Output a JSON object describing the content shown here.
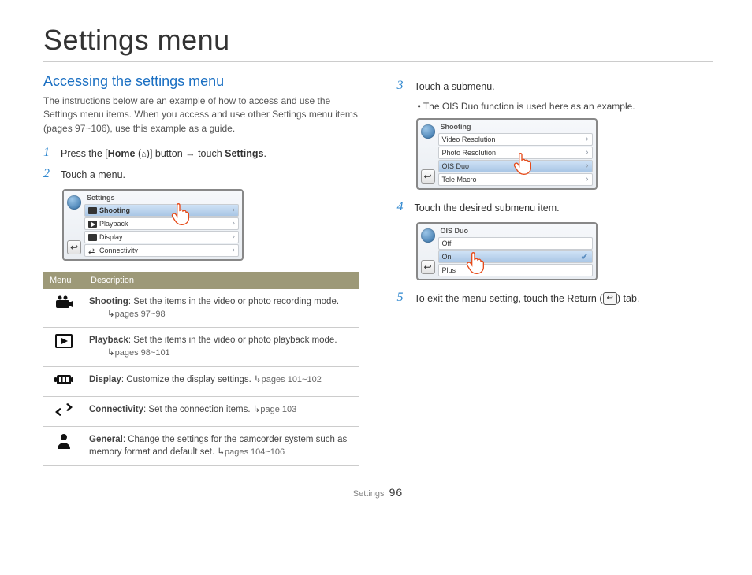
{
  "title": "Settings menu",
  "left": {
    "heading": "Accessing the settings menu",
    "intro": "The instructions below are an example of how to access and use the Settings menu items. When you access and use other Settings menu items (pages 97~106), use this example as a guide.",
    "step1_prefix": "Press the [",
    "step1_home": "Home",
    "step1_mid": " (",
    "step1_after_icon": ")] button → touch ",
    "step1_settings": "Settings",
    "step1_end": ".",
    "step2": "Touch a menu.",
    "device1": {
      "title": "Settings",
      "rows": [
        "Shooting",
        "Playback",
        "Display",
        "Connectivity"
      ]
    },
    "table": {
      "h1": "Menu",
      "h2": "Description",
      "rows": [
        {
          "icon": "camcorder",
          "name": "Shooting",
          "desc": ": Set the items in the video or photo recording mode.",
          "pages": "pages 97~98"
        },
        {
          "icon": "play",
          "name": "Playback",
          "desc": ": Set the items in the video or photo playback mode.",
          "pages": "pages 98~101"
        },
        {
          "icon": "display",
          "name": "Display",
          "desc": ": Customize the display settings. ",
          "pages": "pages 101~102"
        },
        {
          "icon": "connectivity",
          "name": "Connectivity",
          "desc": ": Set the connection items. ",
          "pages": "page 103"
        },
        {
          "icon": "person",
          "name": "General",
          "desc": ": Change the settings for the camcorder system such as memory format and default set. ",
          "pages": "pages 104~106"
        }
      ]
    }
  },
  "right": {
    "step3": "Touch a submenu.",
    "step3_sub": "The OIS Duo function is used here as an example.",
    "device2": {
      "title": "Shooting",
      "rows": [
        "Video Resolution",
        "Photo Resolution",
        "OIS Duo",
        "Tele Macro"
      ]
    },
    "step4": "Touch the desired submenu item.",
    "device3": {
      "title": "OIS Duo",
      "rows": [
        "Off",
        "On",
        "Plus"
      ]
    },
    "step5_a": "To exit the menu setting, touch the Return (",
    "step5_b": ") tab."
  },
  "footer_label": "Settings",
  "page_number": "96",
  "icons": {
    "home": "⌂",
    "back": "↩",
    "arrow_hook": "↳"
  }
}
